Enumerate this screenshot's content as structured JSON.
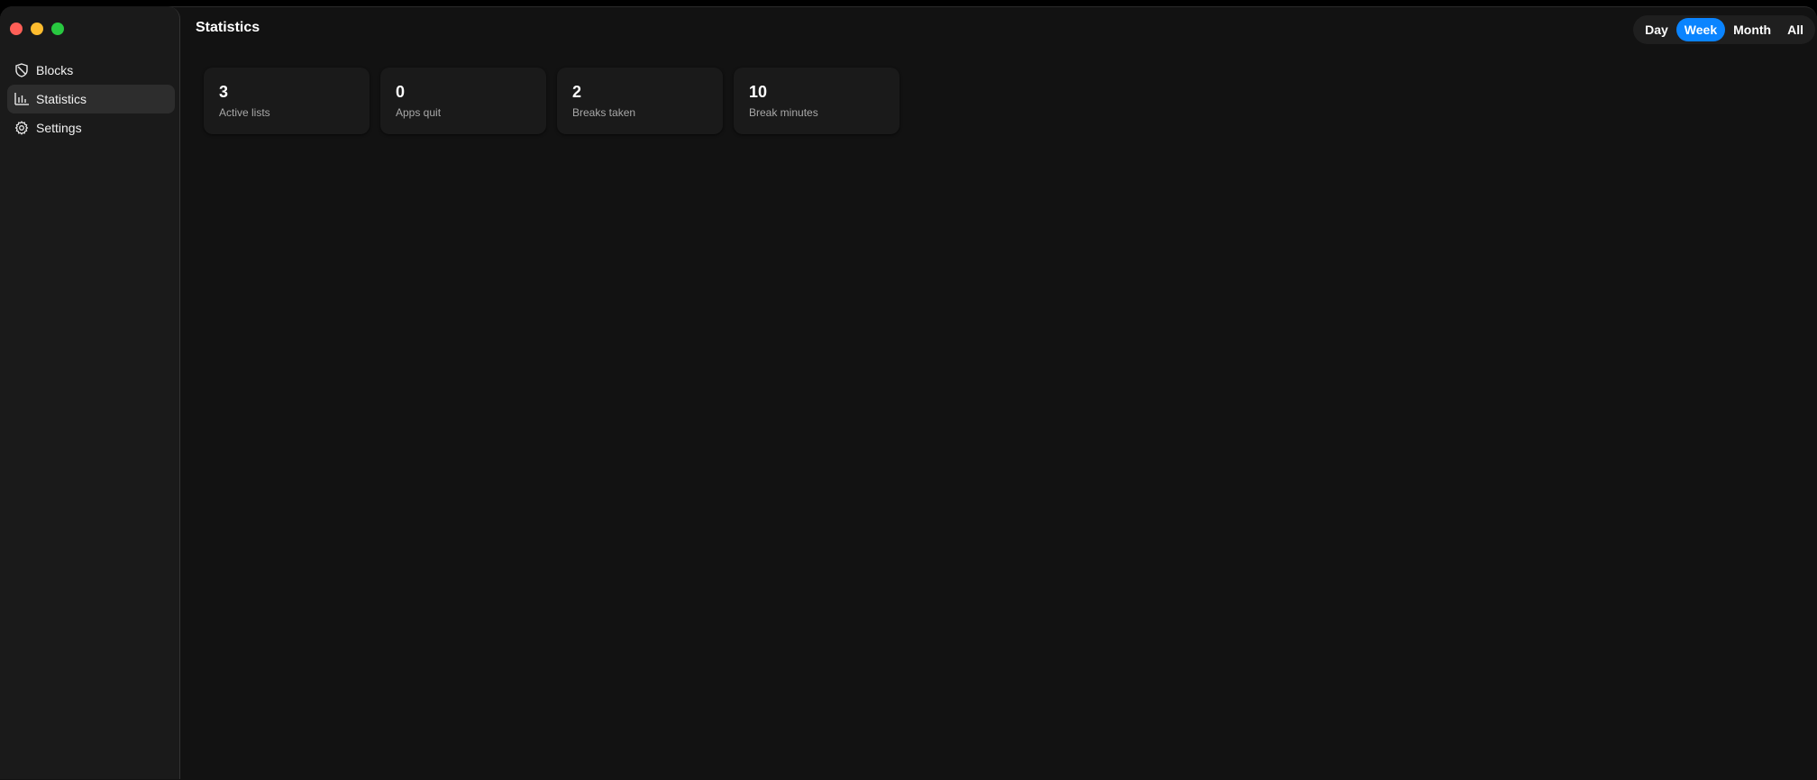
{
  "window": {
    "controls": {
      "close_color": "#ff5f57",
      "minimize_color": "#febc2e",
      "maximize_color": "#28c840"
    }
  },
  "sidebar": {
    "items": [
      {
        "label": "Blocks",
        "icon": "shield-icon",
        "active": false
      },
      {
        "label": "Statistics",
        "icon": "bar-chart-icon",
        "active": true
      },
      {
        "label": "Settings",
        "icon": "gear-icon",
        "active": false
      }
    ]
  },
  "header": {
    "title": "Statistics"
  },
  "range_selector": {
    "options": [
      "Day",
      "Week",
      "Month",
      "All"
    ],
    "selected": "Week",
    "accent_color": "#0a84ff"
  },
  "stats": [
    {
      "value": "3",
      "label": "Active lists"
    },
    {
      "value": "0",
      "label": "Apps quit"
    },
    {
      "value": "2",
      "label": "Breaks taken"
    },
    {
      "value": "10",
      "label": "Break minutes"
    }
  ]
}
